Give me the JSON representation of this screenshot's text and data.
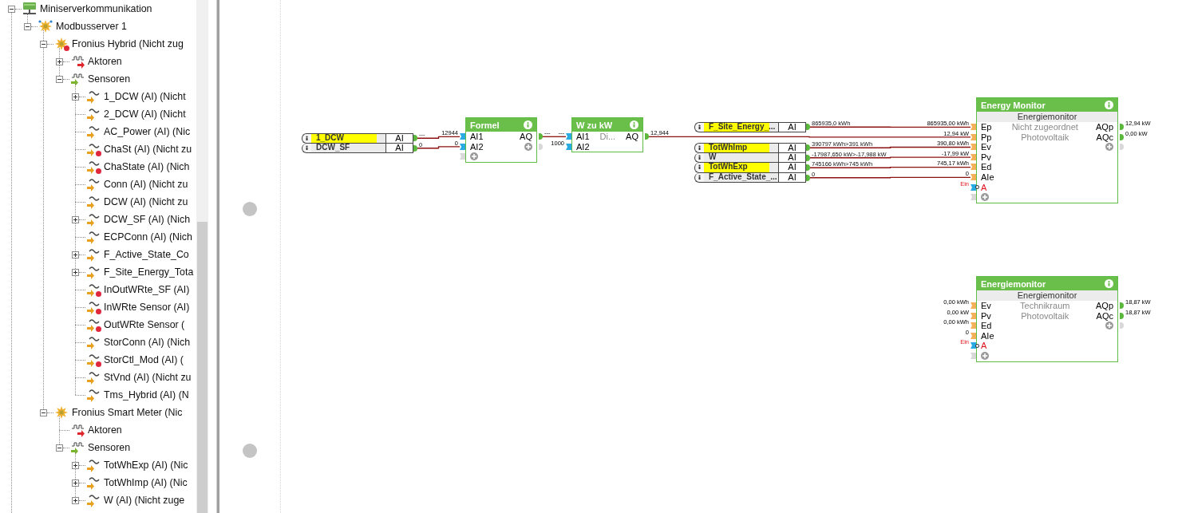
{
  "tree": [
    {
      "label": "Miniserverkommunikation",
      "kind": "network",
      "expanded": true,
      "error": false,
      "children": [
        {
          "label": "Modbusserver 1",
          "kind": "server",
          "expanded": true,
          "error": false,
          "children": [
            {
              "label": "Fronius Hybrid (Nicht zug",
              "kind": "device",
              "expanded": true,
              "error": true,
              "children": [
                {
                  "label": "Aktoren",
                  "kind": "actors",
                  "expanded": false,
                  "error": false
                },
                {
                  "label": "Sensoren",
                  "kind": "sensors",
                  "expanded": true,
                  "error": false,
                  "children": [
                    {
                      "label": "1_DCW (AI) (Nicht",
                      "kind": "sensor",
                      "expanded": false,
                      "error": false
                    },
                    {
                      "label": "2_DCW (AI) (Nicht",
                      "kind": "sensor",
                      "error": false
                    },
                    {
                      "label": "AC_Power (AI) (Nic",
                      "kind": "sensor",
                      "error": false
                    },
                    {
                      "label": "ChaSt (AI) (Nicht zu",
                      "kind": "sensor",
                      "error": true
                    },
                    {
                      "label": "ChaState (AI) (Nich",
                      "kind": "sensor",
                      "error": true
                    },
                    {
                      "label": "Conn (AI) (Nicht zu",
                      "kind": "sensor",
                      "error": false
                    },
                    {
                      "label": "DCW (AI) (Nicht zu",
                      "kind": "sensor",
                      "error": false
                    },
                    {
                      "label": "DCW_SF (AI) (Nich",
                      "kind": "sensor",
                      "expanded": false,
                      "error": false
                    },
                    {
                      "label": "ECPConn (AI) (Nich",
                      "kind": "sensor",
                      "error": false
                    },
                    {
                      "label": "F_Active_State_Co",
                      "kind": "sensor",
                      "expanded": false,
                      "error": false
                    },
                    {
                      "label": "F_Site_Energy_Tota",
                      "kind": "sensor",
                      "expanded": false,
                      "error": false
                    },
                    {
                      "label": "InOutWRte_SF (AI)",
                      "kind": "sensor",
                      "error": true
                    },
                    {
                      "label": "InWRte Sensor (AI)",
                      "kind": "sensor",
                      "error": true
                    },
                    {
                      "label": "OutWRte Sensor (",
                      "kind": "sensor",
                      "error": true
                    },
                    {
                      "label": "StorConn (AI) (Nich",
                      "kind": "sensor",
                      "error": false
                    },
                    {
                      "label": "StorCtl_Mod (AI) (",
                      "kind": "sensor",
                      "error": true
                    },
                    {
                      "label": "StVnd (AI) (Nicht zu",
                      "kind": "sensor",
                      "error": false
                    },
                    {
                      "label": "Tms_Hybrid (AI) (N",
                      "kind": "sensor",
                      "error": false
                    }
                  ]
                }
              ]
            },
            {
              "label": "Fronius Smart Meter (Nic",
              "kind": "device",
              "expanded": true,
              "error": false,
              "children": [
                {
                  "label": "Aktoren",
                  "kind": "actors",
                  "error": false
                },
                {
                  "label": "Sensoren",
                  "kind": "sensors",
                  "expanded": true,
                  "error": false,
                  "children": [
                    {
                      "label": "TotWhExp (AI) (Nic",
                      "kind": "sensor",
                      "expanded": false,
                      "error": false
                    },
                    {
                      "label": "TotWhImp (AI) (Nic",
                      "kind": "sensor",
                      "expanded": false,
                      "error": false
                    },
                    {
                      "label": "W (AI) (Nicht zuge",
                      "kind": "sensor",
                      "expanded": false,
                      "error": false
                    }
                  ]
                }
              ]
            }
          ]
        }
      ]
    }
  ],
  "input_groups": [
    {
      "rows": [
        {
          "label": "1_DCW",
          "highlighted": true,
          "type": "AI",
          "value": "---"
        },
        {
          "label": "DCW_SF",
          "highlighted": false,
          "type": "AI",
          "value": "0"
        }
      ]
    },
    {
      "rows": [
        {
          "label": "F_Site_Energy_...",
          "highlighted": true,
          "type": "AI",
          "value": "865935,0 kWh"
        }
      ]
    },
    {
      "rows": [
        {
          "label": "TotWhImp",
          "highlighted": true,
          "type": "AI",
          "value": "390797 kWh>391 kWh"
        },
        {
          "label": "W",
          "highlighted": false,
          "type": "AI",
          "value": "-17987,650 kW>-17,988 kW"
        },
        {
          "label": "TotWhExp",
          "highlighted": true,
          "type": "AI",
          "value": "745166 kWh>745 kWh"
        },
        {
          "label": "F_Active_State_...",
          "highlighted": false,
          "type": "AI",
          "value": "0"
        }
      ]
    }
  ],
  "blocks": [
    {
      "title": "Formel",
      "inputs": [
        {
          "label": "AI1",
          "value": "12944",
          "kind": "analog",
          "color": "#29abe2"
        },
        {
          "label": "AI2",
          "value": "0",
          "kind": "analog",
          "color": "#29abe2"
        }
      ],
      "outputs": [
        {
          "label": "AQ",
          "value": "---"
        }
      ],
      "add_input": true,
      "add_output": true
    },
    {
      "title": "W zu kW",
      "lines": [
        "Di..."
      ],
      "inputs": [
        {
          "label": "AI1",
          "value": "---",
          "kind": "analog",
          "color": "#29abe2"
        },
        {
          "label": "AI2",
          "value": "1000",
          "kind": "analog",
          "color": "#29abe2"
        }
      ],
      "outputs": [
        {
          "label": "AQ",
          "value": "12,944"
        }
      ],
      "add_input": false,
      "add_output": false
    },
    {
      "title": "Energy Monitor",
      "band": "Energiemonitor",
      "lines": [
        "Nicht zugeordnet",
        "Photovoltaik"
      ],
      "inputs": [
        {
          "label": "Ep",
          "value": "865935,00 kWh",
          "kind": "analog",
          "color": "#f5b15a"
        },
        {
          "label": "Pp",
          "value": "12,94 kW",
          "kind": "analog",
          "color": "#f5b15a"
        },
        {
          "label": "Ev",
          "value": "390,80 kWh",
          "kind": "analog",
          "color": "#f5b15a"
        },
        {
          "label": "Pv",
          "value": "-17,99 kW",
          "kind": "analog",
          "color": "#f5b15a"
        },
        {
          "label": "Ed",
          "value": "745,17 kWh",
          "kind": "analog",
          "color": "#f5b15a"
        },
        {
          "label": "AIe",
          "value": "0",
          "kind": "analog",
          "color": "#f5b15a"
        },
        {
          "label": "A",
          "value": "Ein",
          "kind": "digital",
          "color": "#29abe2"
        }
      ],
      "outputs": [
        {
          "label": "AQp",
          "value": "12,94 kW"
        },
        {
          "label": "AQc",
          "value": "0,00 kW"
        }
      ],
      "add_input": true,
      "add_output": true
    },
    {
      "title": "Energiemonitor",
      "band": "Energiemonitor",
      "lines": [
        "Technikraum",
        "Photovoltaik"
      ],
      "inputs": [
        {
          "label": "Ev",
          "value": "0,00 kWh",
          "kind": "analog",
          "color": "#f5b15a"
        },
        {
          "label": "Pv",
          "value": "0,00 kW",
          "kind": "analog",
          "color": "#f5b15a"
        },
        {
          "label": "Ed",
          "value": "0,00 kWh",
          "kind": "analog",
          "color": "#f5b15a"
        },
        {
          "label": "AIe",
          "value": "0",
          "kind": "analog",
          "color": "#f5b15a"
        },
        {
          "label": "A",
          "value": "Ein",
          "kind": "digital",
          "color": "#29abe2"
        }
      ],
      "outputs": [
        {
          "label": "AQp",
          "value": "18,87 kW"
        },
        {
          "label": "AQc",
          "value": "18,87 kW"
        }
      ],
      "add_input": true,
      "add_output": true
    }
  ]
}
